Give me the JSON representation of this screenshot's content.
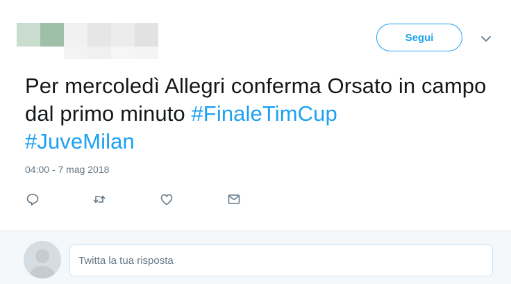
{
  "header": {
    "follow_label": "Segui",
    "more_icon": "chevron-down-icon"
  },
  "tweet": {
    "text_plain": "Per mercoledì Allegri conferma Orsato in campo dal primo minuto ",
    "hashtags": [
      "#FinaleTimCup",
      "#JuveMilan"
    ],
    "timestamp": "04:00 - 7 mag 2018"
  },
  "actions": [
    {
      "name": "reply-icon"
    },
    {
      "name": "retweet-icon"
    },
    {
      "name": "like-icon"
    },
    {
      "name": "message-icon"
    }
  ],
  "reply": {
    "placeholder": "Twitta la tua risposta"
  },
  "colors": {
    "accent": "#1da1f2",
    "text": "#14171a",
    "muted": "#657786",
    "reply_bg": "#f5f8fa"
  }
}
